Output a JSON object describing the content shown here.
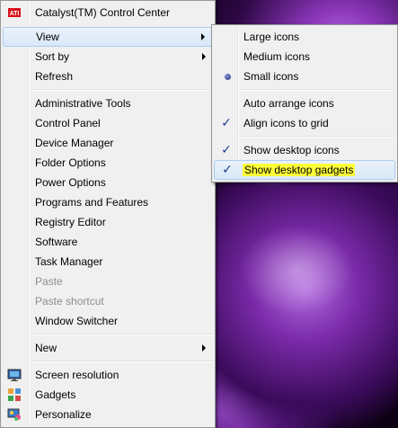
{
  "main_menu": {
    "items": [
      {
        "label": "Catalyst(TM) Control Center",
        "icon": "ati-icon"
      },
      {
        "label": "View",
        "submenu": true
      },
      {
        "label": "Sort by",
        "submenu": true
      },
      {
        "label": "Refresh"
      },
      {
        "label": "Administrative Tools"
      },
      {
        "label": "Control Panel"
      },
      {
        "label": "Device Manager"
      },
      {
        "label": "Folder Options"
      },
      {
        "label": "Power Options"
      },
      {
        "label": "Programs and Features"
      },
      {
        "label": "Registry Editor"
      },
      {
        "label": "Software"
      },
      {
        "label": "Task Manager"
      },
      {
        "label": "Paste",
        "disabled": true
      },
      {
        "label": "Paste shortcut",
        "disabled": true
      },
      {
        "label": "Window Switcher"
      },
      {
        "label": "New",
        "submenu": true
      },
      {
        "label": "Screen resolution",
        "icon": "monitor-icon"
      },
      {
        "label": "Gadgets",
        "icon": "gadgets-icon"
      },
      {
        "label": "Personalize",
        "icon": "personalize-icon"
      }
    ]
  },
  "view_submenu": {
    "items": [
      {
        "label": "Large icons"
      },
      {
        "label": "Medium icons"
      },
      {
        "label": "Small icons",
        "selected_radio": true
      },
      {
        "label": "Auto arrange icons"
      },
      {
        "label": "Align icons to grid",
        "checked": true
      },
      {
        "label": "Show desktop icons",
        "checked": true
      },
      {
        "label": "Show desktop gadgets",
        "checked": true,
        "highlighted": true
      }
    ]
  },
  "colors": {
    "menu_bg": "#f0f0f0",
    "hover_border": "#aecbee",
    "highlight": "#ffff3a",
    "check": "#1c3c8c",
    "wallpaper_accent": "#8a36b8"
  }
}
